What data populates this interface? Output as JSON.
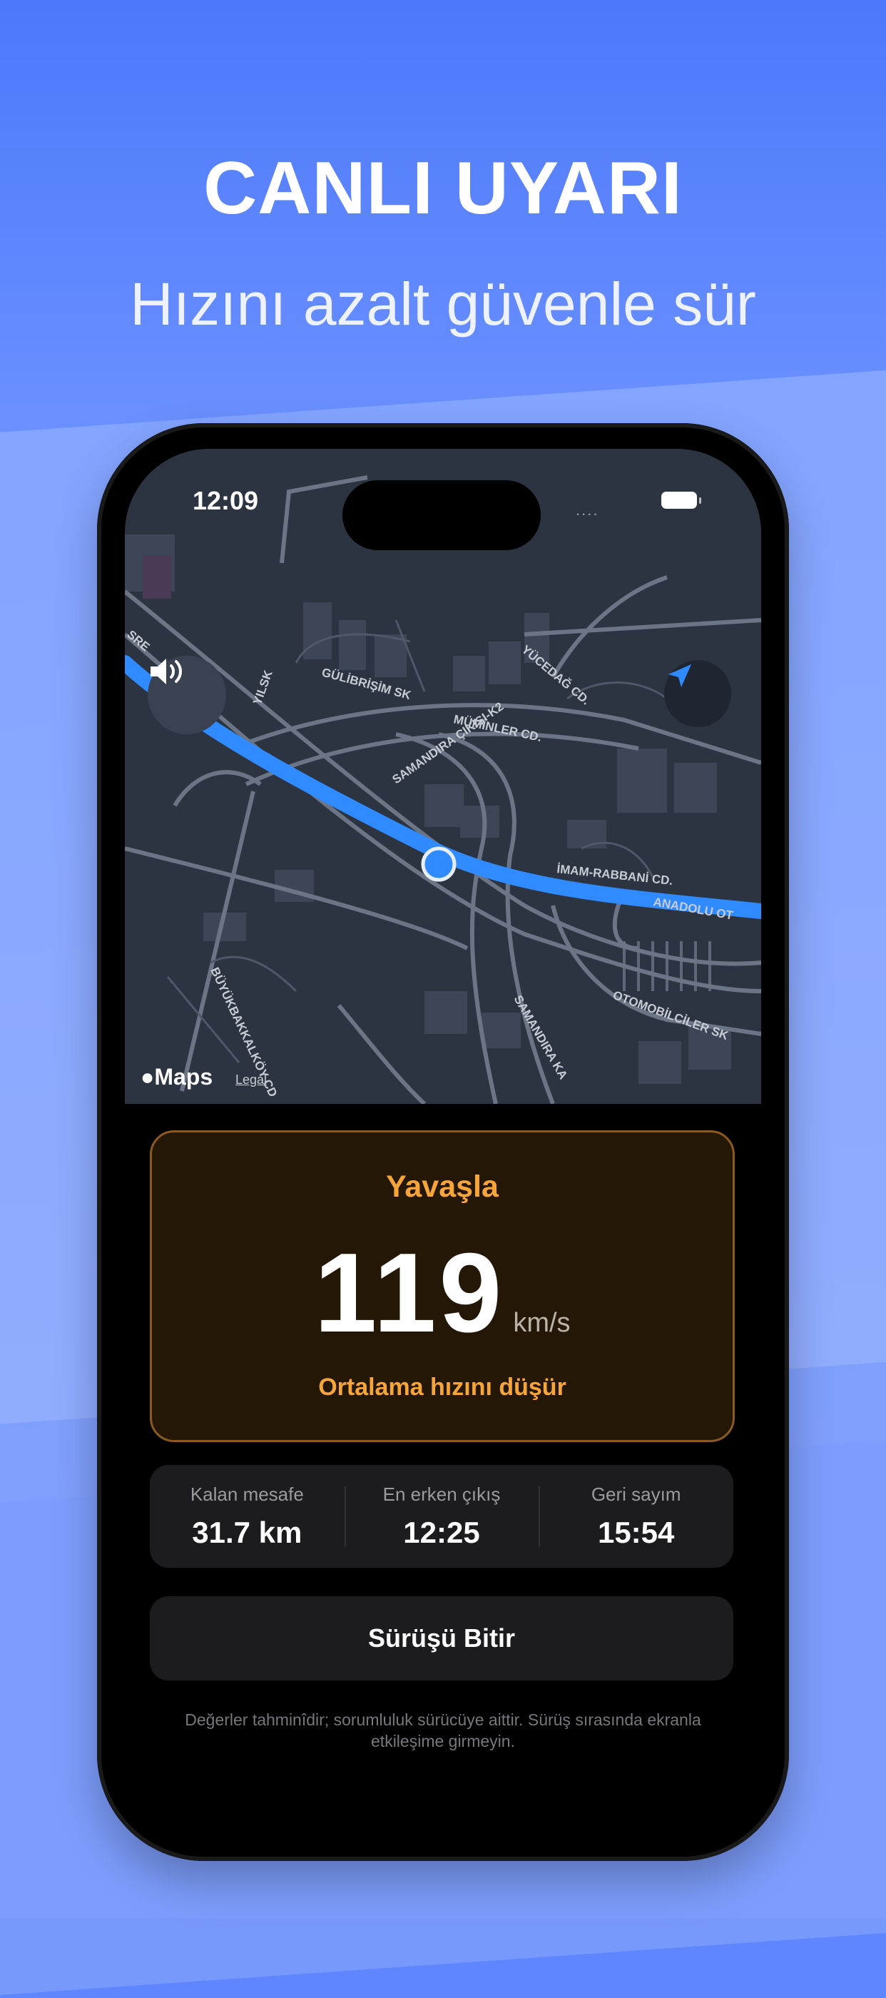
{
  "promo": {
    "headline": "CANLI UYARI",
    "subline": "Hızını azalt güvenle sür"
  },
  "status_bar": {
    "time": "12:09",
    "signal": "....",
    "battery": "full"
  },
  "map": {
    "attribution_logo": "Maps",
    "legal_link": "Legal",
    "street_labels": [
      "GÜLİBRİŞİM SK",
      "MÜMİNLER CD.",
      "YÜCEDAĞ CD.",
      "SAMANDIRA ÇIKIŞI-K2",
      "İMAM-RABBANİ CD.",
      "ANADOLU OT",
      "OTOMOBİLCİLER SK",
      "BÜYÜKBAKKALKÖY CD",
      "SAMANDIRA KA",
      "YILSK",
      "SRE"
    ],
    "sound_icon": "speaker-icon",
    "nav_icon": "location-arrow-icon"
  },
  "alert": {
    "title": "Yavaşla",
    "speed": "119",
    "unit": "km/s",
    "subtitle": "Ortalama hızını düşür",
    "accent_color": "#f6a53a"
  },
  "stats": [
    {
      "label": "Kalan mesafe",
      "value": "31.7 km"
    },
    {
      "label": "En erken çıkış",
      "value": "12:25"
    },
    {
      "label": "Geri sayım",
      "value": "15:54"
    }
  ],
  "finish_button": {
    "label": "Sürüşü Bitir"
  },
  "disclaimer": "Değerler tahminîdir; sorumluluk sürücüye aittir. Sürüş sırasında ekranla etkileşime girmeyin."
}
